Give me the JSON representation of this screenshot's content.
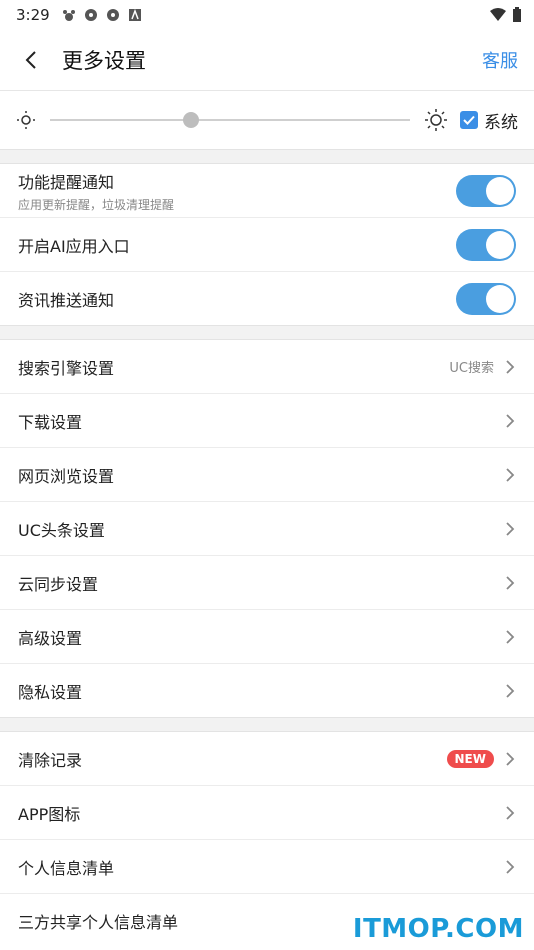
{
  "status_bar": {
    "time": "3:29"
  },
  "header": {
    "title": "更多设置",
    "service": "客服"
  },
  "brightness": {
    "level": 0.37,
    "system_label": "系统",
    "system_checked": true
  },
  "toggles": [
    {
      "label": "功能提醒通知",
      "sub": "应用更新提醒，垃圾清理提醒",
      "on": true
    },
    {
      "label": "开启AI应用入口",
      "on": true
    },
    {
      "label": "资讯推送通知",
      "on": true
    }
  ],
  "settings": [
    {
      "label": "搜索引擎设置",
      "value": "UC搜索"
    },
    {
      "label": "下载设置"
    },
    {
      "label": "网页浏览设置"
    },
    {
      "label": "UC头条设置"
    },
    {
      "label": "云同步设置"
    },
    {
      "label": "高级设置"
    },
    {
      "label": "隐私设置"
    }
  ],
  "more": [
    {
      "label": "清除记录",
      "badge": "NEW"
    },
    {
      "label": "APP图标"
    },
    {
      "label": "个人信息清单"
    },
    {
      "label": "三方共享个人信息清单"
    }
  ],
  "watermark": "ITMOP.COM",
  "colors": {
    "accent": "#3a8ee6",
    "toggle": "#4a9ee0",
    "badge": "#ef4c4c"
  }
}
